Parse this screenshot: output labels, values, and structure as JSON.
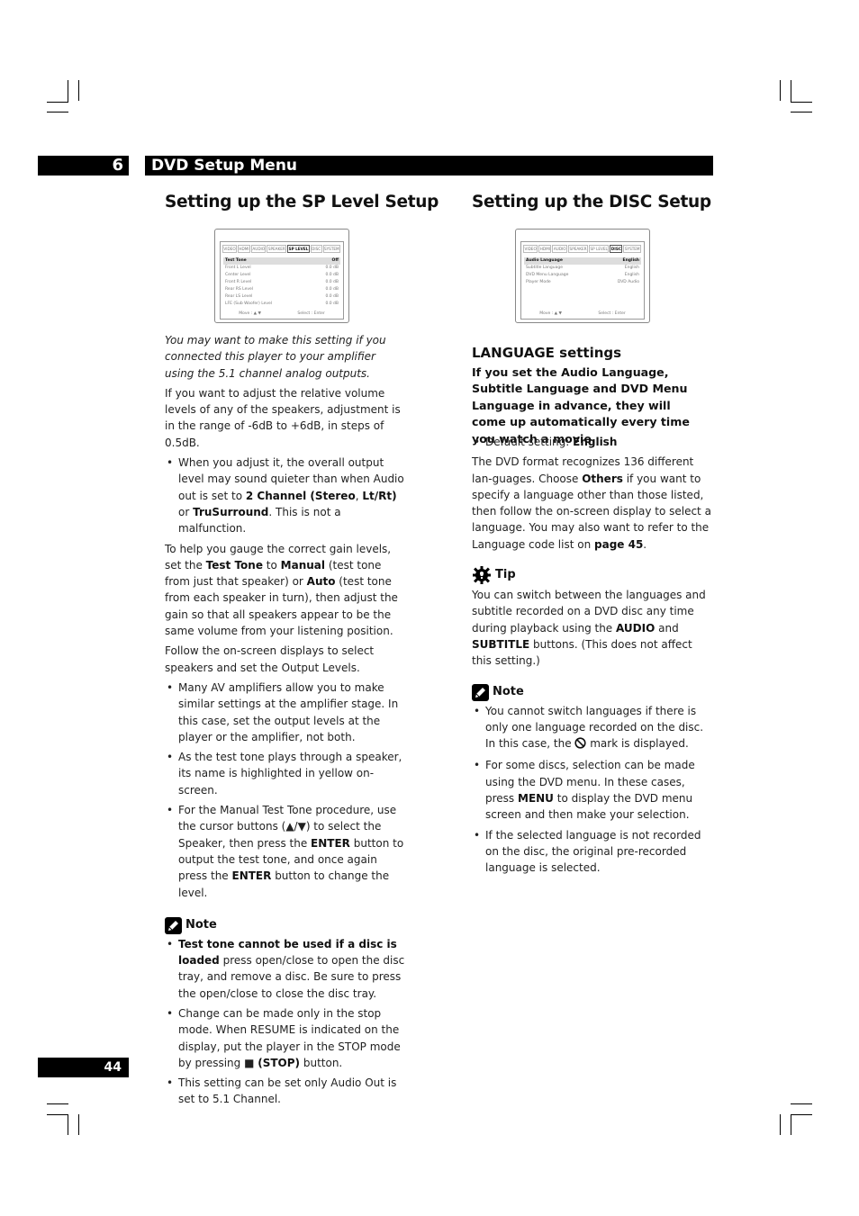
{
  "chapter": {
    "number": "6",
    "title": "DVD Setup Menu"
  },
  "left": {
    "title": "Setting up the SP Level Setup",
    "osd": {
      "tabs": [
        "VIDEO",
        "HDMI",
        "AUDIO",
        "SPEAKER",
        "SP LEVEL",
        "DISC",
        "SYSTEM"
      ],
      "active_tab": "SP LEVEL",
      "rows": [
        {
          "label": "Test Tone",
          "value": "Off"
        },
        {
          "label": "Front L Level",
          "value": "0.0 dB"
        },
        {
          "label": "Center Level",
          "value": "0.0 dB"
        },
        {
          "label": "Front R Level",
          "value": "0.0 dB"
        },
        {
          "label": "Rear RS Level",
          "value": "0.0 dB"
        },
        {
          "label": "Rear LS Level",
          "value": "0.0 dB"
        },
        {
          "label": "LFE (Sub Woofer) Level",
          "value": "0.0 dB"
        }
      ],
      "footer_move": "Move : ▲ ▼",
      "footer_select": "Select : Enter"
    },
    "intro_italic": "You may want to make this setting if you connected this player to your amplifier using the 5.1 channel analog outputs.",
    "para1": "If you want to adjust the relative volume levels of any of the speakers, adjustment is in the range of -6dB to +6dB, in steps of 0.5dB.",
    "bullet1": {
      "pre": "When you adjust it, the overall output level may sound quieter than when Audio out is set to ",
      "b1": "2 Channel (Stereo",
      "mid1": ", ",
      "b2": "Lt/Rt)",
      "mid2": " or ",
      "b3": "TruSurround",
      "post": ". This is not a malfunction."
    },
    "para2": {
      "pre": "To help you gauge the correct gain levels, set the ",
      "b1": "Test Tone",
      "mid1": " to ",
      "b2": "Manual",
      "mid2": " (test tone from just that speaker) or ",
      "b3": "Auto",
      "post": " (test tone from each speaker in turn), then adjust the gain so that all speakers appear to be the same volume from your listening position."
    },
    "para3": "Follow the on-screen displays to select speakers and set the Output Levels.",
    "bullets2": [
      "Many AV amplifiers allow you to make similar settings at the amplifier stage. In this case, set the output levels at the player or the amplifier, not both.",
      "As the test tone plays through a speaker, its name is highlighted in yellow on-screen."
    ],
    "bullet3": {
      "pre": "For the Manual Test Tone procedure, use the cursor buttons (▲/▼) to select the Speaker, then press the ",
      "b1": "ENTER",
      "mid": " button to output the test tone, and once again press the ",
      "b2": "ENTER",
      "post": " button to change the level."
    },
    "note": {
      "label": "Note",
      "bullet1": {
        "b": "Test tone cannot be used if a disc is loaded",
        "post": " press open/close to open the disc tray, and remove a disc. Be sure to press the open/close to close the disc tray."
      },
      "bullet2": {
        "pre": "Change can be made only in the stop mode. When RESUME is indicated on the display, put the player in the STOP mode by pressing ■ ",
        "b": "(STOP)",
        "post": " button."
      },
      "bullet3": "This setting can be set only Audio Out is set to 5.1 Channel."
    }
  },
  "right": {
    "title": "Setting up the DISC Setup",
    "osd": {
      "tabs": [
        "VIDEO",
        "HDMI",
        "AUDIO",
        "SPEAKER",
        "SP LEVEL",
        "DISC",
        "SYSTEM"
      ],
      "active_tab": "DISC",
      "rows": [
        {
          "label": "Audio Language",
          "value": "English"
        },
        {
          "label": "Subtitle Language",
          "value": "English"
        },
        {
          "label": "DVD Menu Language",
          "value": "English"
        },
        {
          "label": "Player Mode",
          "value": "DVD Audio"
        }
      ],
      "footer_move": "Move : ▲ ▼",
      "footer_select": "Select : Enter"
    },
    "subheading": "LANGUAGE settings",
    "lead": "If you set the Audio Language, Subtitle Language and DVD Menu Language in advance, they will come up automatically every time you watch a movie.",
    "default": {
      "pre": "Default setting: ",
      "b": "English"
    },
    "para": {
      "pre": "The DVD format recognizes 136 different lan-guages. Choose ",
      "b1": "Others",
      "mid": " if you want to specify a language other than those listed, then follow the on-screen display to select a language. You may also want to refer to the Language code list on ",
      "b2": "page 45",
      "post": "."
    },
    "tip": {
      "label": "Tip",
      "pre": "You can switch between the languages and subtitle recorded on a DVD disc any time during playback using the ",
      "b1": "AUDIO",
      "mid": " and ",
      "b2": "SUBTITLE",
      "post": " buttons. (This does not affect this setting.)"
    },
    "note": {
      "label": "Note",
      "bullet1": {
        "pre": "You cannot switch languages if there is only one language recorded on the disc. In this case, the ",
        "post": " mark is displayed."
      },
      "bullet2": {
        "pre": "For some discs, selection can be made using the DVD menu. In these cases, press ",
        "b": "MENU",
        "post": " to display the DVD menu screen and then make your selection."
      },
      "bullet3": "If the selected language is not recorded on the disc, the original pre-recorded language is selected."
    }
  },
  "page_number": "44"
}
